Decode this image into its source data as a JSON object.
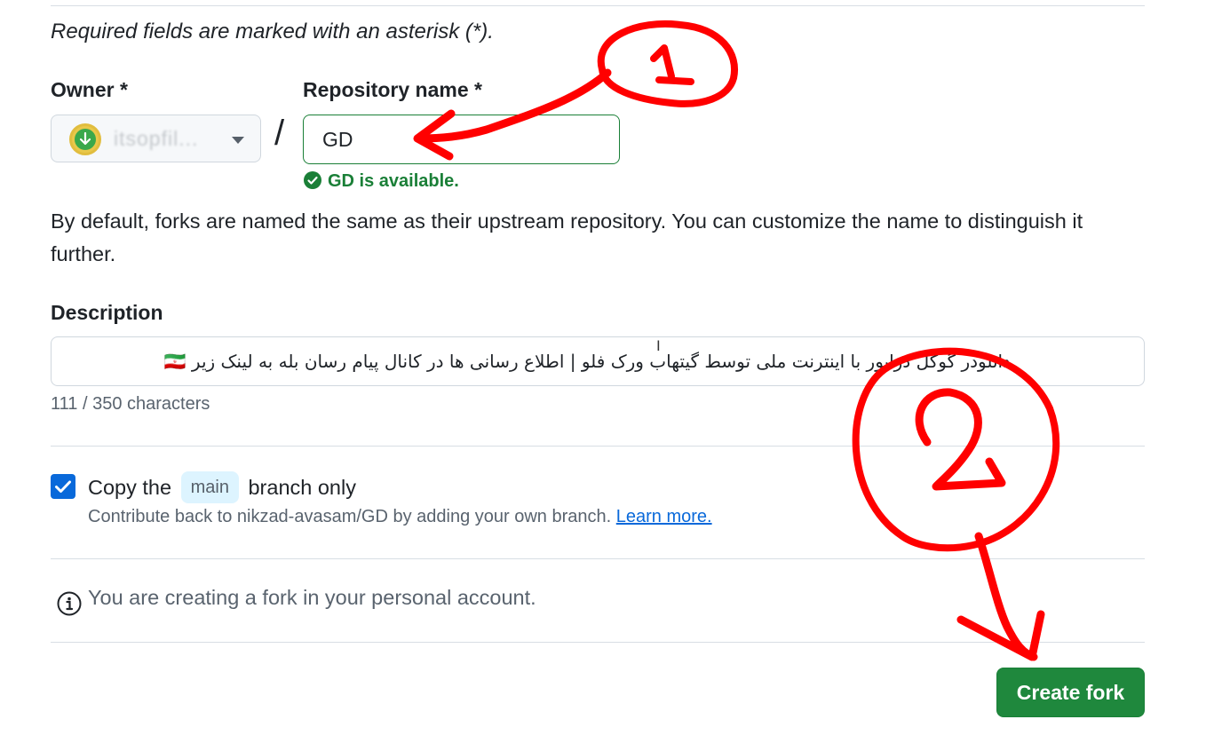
{
  "form": {
    "required_note": "Required fields are marked with an asterisk (*).",
    "owner_label": "Owner *",
    "owner_value": "itsopfil...",
    "separator": "/",
    "repo_label": "Repository name *",
    "repo_value": "GD",
    "repo_status": "GD is available.",
    "repo_help": "By default, forks are named the same as their upstream repository. You can customize the name to distinguish it further.",
    "description_label": "Description",
    "description_value": "دانلودر گوگل درایور با اینترنت ملی توسط گیتهاب ورک فلو | اطلاع رسانی ها در کانال پیام رسان بله به لینک زیر 🇮🇷",
    "char_count": "111 / 350 characters",
    "copy_prefix": "Copy the",
    "copy_branch": "main",
    "copy_suffix": "branch only",
    "copy_checked": true,
    "contribute_text": "Contribute back to nikzad-avasam/GD by adding your own branch.",
    "learn_more": "Learn more.",
    "info_text": "You are creating a fork in your personal account.",
    "create_button": "Create fork"
  },
  "annotations": {
    "marker_1": "1",
    "marker_2": "2",
    "color": "#ff0000"
  },
  "colors": {
    "success": "#1a7f37",
    "primary_button": "#1f883d",
    "checkbox": "#0969da",
    "link": "#0969da"
  }
}
